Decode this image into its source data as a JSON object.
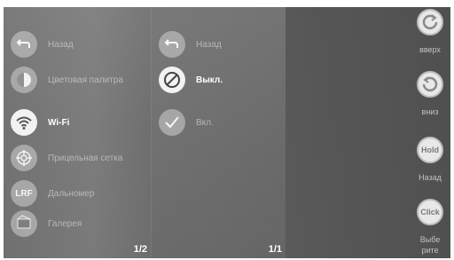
{
  "main_menu": {
    "items": [
      {
        "label": "Назад",
        "icon": "back-icon"
      },
      {
        "label": "Цветовая палитра",
        "icon": "palette-icon"
      },
      {
        "label": "Wi-Fi",
        "icon": "wifi-icon"
      },
      {
        "label": "Прицельная сетка",
        "icon": "reticle-icon"
      },
      {
        "label": "Дальномер",
        "icon": "rangefinder-icon",
        "glyph": "LRF"
      },
      {
        "label": "Галерея",
        "icon": "gallery-icon"
      }
    ],
    "page_indicator": "1/2"
  },
  "sub_menu": {
    "items": [
      {
        "label": "Назад",
        "icon": "back-icon"
      },
      {
        "label": "Выкл.",
        "icon": "off-icon"
      },
      {
        "label": "Вкл.",
        "icon": "check-icon"
      }
    ],
    "page_indicator": "1/1"
  },
  "controls": [
    {
      "label": "вверх",
      "icon": "rotate-up-icon"
    },
    {
      "label": "вниз",
      "icon": "rotate-down-icon"
    },
    {
      "label": "Назад",
      "button_text": "Hold"
    },
    {
      "label": "Выбе рите",
      "button_text": "Click"
    }
  ],
  "colors": {
    "active": "#ffffff",
    "inactive": "#d0d0d0",
    "background": "#666666"
  }
}
